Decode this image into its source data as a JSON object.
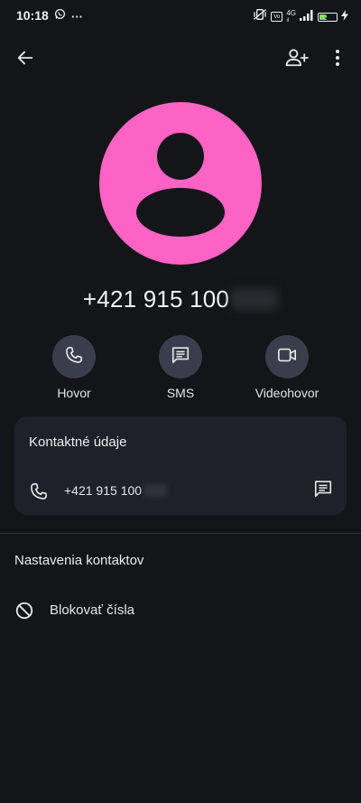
{
  "status_bar": {
    "time": "10:18",
    "overflow": "···",
    "network_small_top": "4G",
    "network_small_bottom": "ıl",
    "volte": "Vo",
    "battery_percent": "3",
    "icons": [
      "whatsapp-icon",
      "vibrate-off-icon",
      "volte-icon",
      "signal-icon",
      "battery-icon",
      "charging-icon"
    ]
  },
  "top_bar": {
    "back_icon": "arrow-left-icon",
    "add_contact_icon": "person-add-icon",
    "more_icon": "more-vert-icon"
  },
  "contact": {
    "avatar_color": "#fd63c3",
    "phone_visible": "+421 915 100"
  },
  "actions": [
    {
      "label": "Hovor",
      "icon": "phone-icon"
    },
    {
      "label": "SMS",
      "icon": "message-icon"
    },
    {
      "label": "Videohovor",
      "icon": "video-icon"
    }
  ],
  "contact_card": {
    "title": "Kontaktné údaje",
    "phone_number": "+421 915 100"
  },
  "settings": {
    "title": "Nastavenia kontaktov",
    "block_label": "Blokovať čísla"
  },
  "colors": {
    "background": "#141519",
    "card": "#1f2128",
    "action_circle": "#3a3d4b",
    "avatar": "#fd63c3"
  }
}
